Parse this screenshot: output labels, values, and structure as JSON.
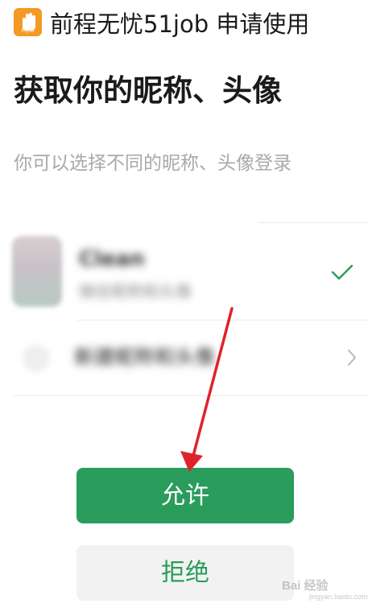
{
  "header": {
    "app_logo_icon": "hand-logo-icon",
    "app_logo_text": "51JOB",
    "title": "前程无忧51job  申请使用"
  },
  "main": {
    "page_title": "获取你的昵称、头像",
    "description": "你可以选择不同的昵称、头像登录"
  },
  "accounts": {
    "profile": {
      "avatar_icon": "avatar",
      "nickname": "Clean",
      "sub_text": "微信昵称和头像",
      "selected": true,
      "check_icon": "check-icon"
    },
    "new_profile": {
      "label": "新建昵称和头像",
      "chevron_icon": "chevron-right-icon"
    }
  },
  "buttons": {
    "allow_label": "允许",
    "deny_label": "拒绝"
  },
  "watermark": {
    "text": "Bai 经验",
    "sub_text": "jingyan.baidu.com"
  },
  "colors": {
    "brand_green": "#2a9c5b",
    "logo_orange": "#f39a24",
    "annotation_red": "#e0232b",
    "muted_text": "#a9a9a9"
  }
}
